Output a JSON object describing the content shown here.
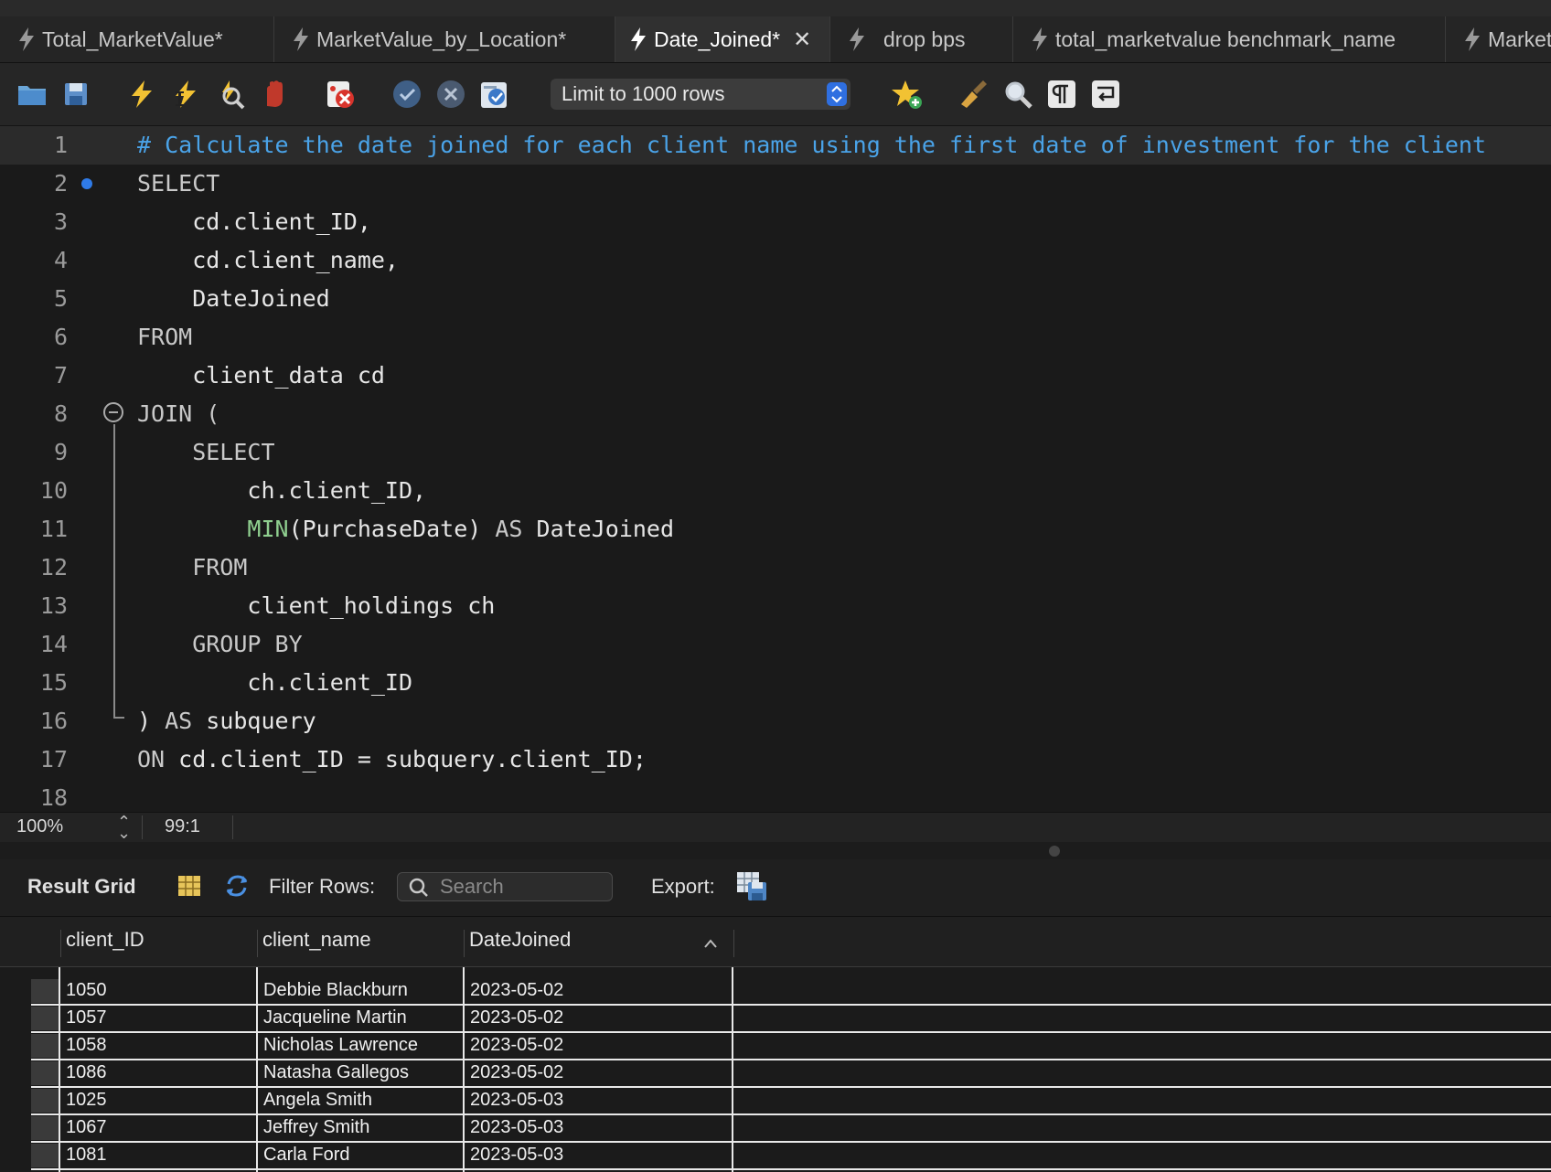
{
  "tabs": [
    {
      "label": "Total_MarketValue*",
      "active": false
    },
    {
      "label": "MarketValue_by_Location*",
      "active": false
    },
    {
      "label": "Date_Joined*",
      "active": true
    },
    {
      "label": "drop bps",
      "active": false
    },
    {
      "label": "total_marketvalue benchmark_name",
      "active": false
    },
    {
      "label": "Market",
      "active": false
    }
  ],
  "toolbar": {
    "limit_label": "Limit to 1000 rows",
    "icons": [
      "open-folder-icon",
      "save-icon",
      "execute-icon",
      "execute-current-icon",
      "explain-icon",
      "stop-icon",
      "error-toggle-icon",
      "commit-icon",
      "rollback-icon",
      "autocommit-icon",
      "add-snippet-icon",
      "beautify-icon",
      "find-icon",
      "invisible-chars-icon",
      "wrap-lines-icon"
    ]
  },
  "editor": {
    "lines": [
      {
        "n": "1",
        "parts": [
          {
            "t": "# Calculate the date joined for each client name using the first date of investment for the client",
            "c": "cm"
          }
        ]
      },
      {
        "n": "2",
        "parts": [
          {
            "t": "SELECT",
            "c": "kw"
          }
        ]
      },
      {
        "n": "3",
        "parts": [
          {
            "t": "    cd.client_ID,",
            "c": ""
          }
        ]
      },
      {
        "n": "4",
        "parts": [
          {
            "t": "    cd.client_name,",
            "c": ""
          }
        ]
      },
      {
        "n": "5",
        "parts": [
          {
            "t": "    DateJoined",
            "c": ""
          }
        ]
      },
      {
        "n": "6",
        "parts": [
          {
            "t": "FROM",
            "c": "kw"
          }
        ]
      },
      {
        "n": "7",
        "parts": [
          {
            "t": "    client_data cd",
            "c": ""
          }
        ]
      },
      {
        "n": "8",
        "parts": [
          {
            "t": "JOIN (",
            "c": "kw"
          }
        ]
      },
      {
        "n": "9",
        "parts": [
          {
            "t": "    SELECT",
            "c": "kw"
          }
        ]
      },
      {
        "n": "10",
        "parts": [
          {
            "t": "        ch.client_ID,",
            "c": ""
          }
        ]
      },
      {
        "n": "11",
        "parts": [
          {
            "t": "        ",
            "c": ""
          },
          {
            "t": "MIN",
            "c": "fn"
          },
          {
            "t": "(PurchaseDate) ",
            "c": ""
          },
          {
            "t": "AS",
            "c": "kw"
          },
          {
            "t": " DateJoined",
            "c": ""
          }
        ]
      },
      {
        "n": "12",
        "parts": [
          {
            "t": "    FROM",
            "c": "kw"
          }
        ]
      },
      {
        "n": "13",
        "parts": [
          {
            "t": "        client_holdings ch",
            "c": ""
          }
        ]
      },
      {
        "n": "14",
        "parts": [
          {
            "t": "    GROUP BY",
            "c": "kw"
          }
        ]
      },
      {
        "n": "15",
        "parts": [
          {
            "t": "        ch.client_ID",
            "c": ""
          }
        ]
      },
      {
        "n": "16",
        "parts": [
          {
            "t": ") ",
            "c": ""
          },
          {
            "t": "AS",
            "c": "kw"
          },
          {
            "t": " subquery",
            "c": ""
          }
        ]
      },
      {
        "n": "17",
        "parts": [
          {
            "t": "ON",
            "c": "kw"
          },
          {
            "t": " cd.client_ID = subquery.client_ID;",
            "c": ""
          }
        ]
      },
      {
        "n": "18",
        "parts": []
      }
    ]
  },
  "status": {
    "zoom": "100%",
    "cursor": "99:1"
  },
  "result": {
    "title": "Result Grid",
    "filter_label": "Filter Rows:",
    "search_placeholder": "Search",
    "export_label": "Export:",
    "columns": [
      "client_ID",
      "client_name",
      "DateJoined"
    ],
    "rows": [
      [
        "1050",
        "Debbie Blackburn",
        "2023-05-02"
      ],
      [
        "1057",
        "Jacqueline Martin",
        "2023-05-02"
      ],
      [
        "1058",
        "Nicholas Lawrence",
        "2023-05-02"
      ],
      [
        "1086",
        "Natasha Gallegos",
        "2023-05-02"
      ],
      [
        "1025",
        "Angela Smith",
        "2023-05-03"
      ],
      [
        "1067",
        "Jeffrey Smith",
        "2023-05-03"
      ],
      [
        "1081",
        "Carla Ford",
        "2023-05-03"
      ]
    ]
  },
  "colors": {
    "accent": "#2f6fe0",
    "comment": "#4aa3e8",
    "function": "#8fcf8f",
    "bolt": "#f2c233"
  }
}
